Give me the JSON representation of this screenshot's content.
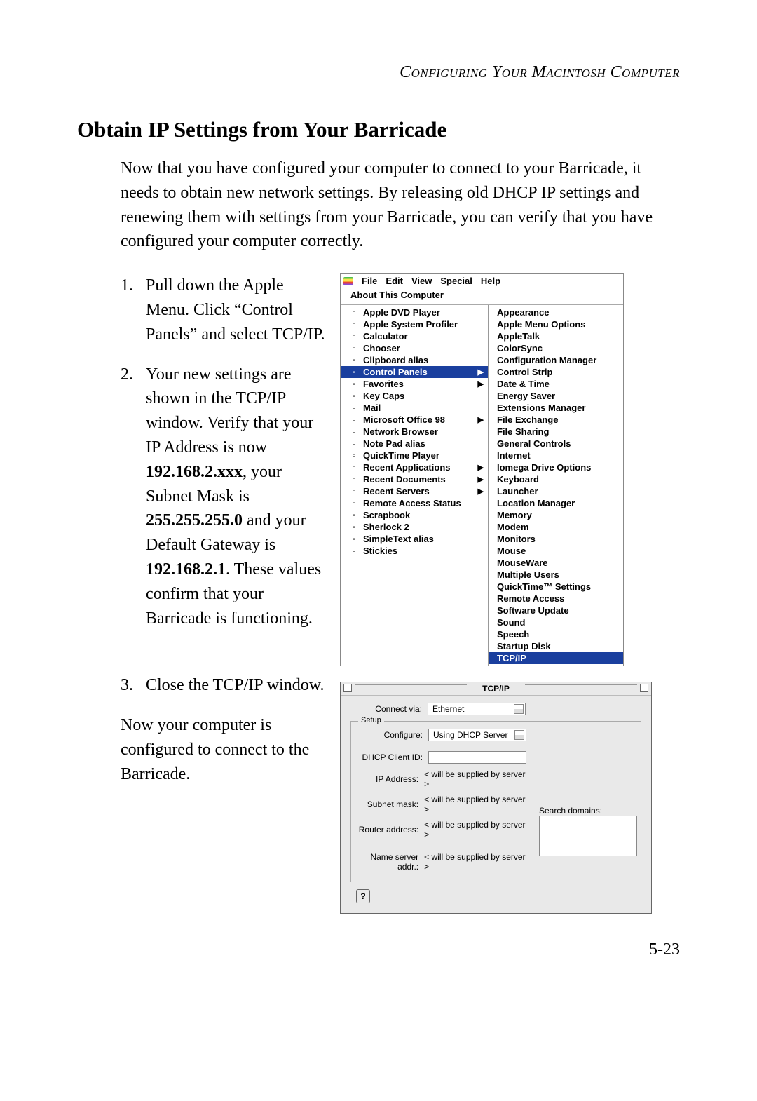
{
  "chapter_header": "Configuring Your Macintosh Computer",
  "section_title": "Obtain IP Settings from Your Barricade",
  "intro": "Now that you have configured your computer to connect to your Barricade, it needs to obtain new network settings. By releasing old DHCP IP settings and renewing them with settings from your Barricade, you can verify that you have configured your computer correctly.",
  "steps": {
    "s1": {
      "num": "1.",
      "text": "Pull down the Apple Menu. Click “Control Panels” and select TCP/IP."
    },
    "s2": {
      "num": "2.",
      "pre": "Your new settings are shown in the TCP/IP window. Verify that your IP Address is now ",
      "ip": "192.168.2.xxx",
      "mid1": ", your Subnet Mask is ",
      "mask": "255.255.255.0",
      "mid2": " and your Default Gateway is ",
      "gw": "192.168.2.1",
      "post": ". These values confirm that your Barricade is functioning."
    },
    "s3": {
      "num": "3.",
      "text": "Close the TCP/IP window."
    }
  },
  "closing": "Now your computer is configured to connect to the Barricade.",
  "page_number": "5-23",
  "mac_menu": {
    "menubar": [
      "File",
      "Edit",
      "View",
      "Special",
      "Help"
    ],
    "top": "About This Computer",
    "left_items": [
      "Apple DVD Player",
      "Apple System Profiler",
      "Calculator",
      "Chooser",
      "Clipboard alias",
      "Control Panels",
      "Favorites",
      "Key Caps",
      "Mail",
      "Microsoft Office 98",
      "Network Browser",
      "Note Pad alias",
      "QuickTime Player",
      "Recent Applications",
      "Recent Documents",
      "Recent Servers",
      "Remote Access Status",
      "Scrapbook",
      "Sherlock 2",
      "SimpleText alias",
      "Stickies"
    ],
    "left_highlight": "Control Panels",
    "left_submenus": [
      "Control Panels",
      "Favorites",
      "Microsoft Office 98",
      "Recent Applications",
      "Recent Documents",
      "Recent Servers"
    ],
    "right_items": [
      "Appearance",
      "Apple Menu Options",
      "AppleTalk",
      "ColorSync",
      "Configuration Manager",
      "Control Strip",
      "Date & Time",
      "Energy Saver",
      "Extensions Manager",
      "File Exchange",
      "File Sharing",
      "General Controls",
      "Internet",
      "Iomega Drive Options",
      "Keyboard",
      "Launcher",
      "Location Manager",
      "Memory",
      "Modem",
      "Monitors",
      "Mouse",
      "MouseWare",
      "Multiple Users",
      "QuickTime™ Settings",
      "Remote Access",
      "Software Update",
      "Sound",
      "Speech",
      "Startup Disk",
      "TCP/IP"
    ],
    "right_highlight": "TCP/IP"
  },
  "tcpip_window": {
    "title": "TCP/IP",
    "connect_via_label": "Connect via:",
    "connect_via_value": "Ethernet",
    "setup_legend": "Setup",
    "configure_label": "Configure:",
    "configure_value": "Using DHCP Server",
    "dhcp_client_id_label": "DHCP Client ID:",
    "dhcp_client_id_value": "",
    "ip_address_label": "IP Address:",
    "ip_address_value": "< will be supplied by server >",
    "subnet_mask_label": "Subnet mask:",
    "subnet_mask_value": "< will be supplied by server >",
    "router_address_label": "Router address:",
    "router_address_value": "< will be supplied by server >",
    "name_server_label": "Name server addr.:",
    "name_server_value": "< will be supplied by server >",
    "search_domains_label": "Search domains:",
    "help_button": "?"
  }
}
